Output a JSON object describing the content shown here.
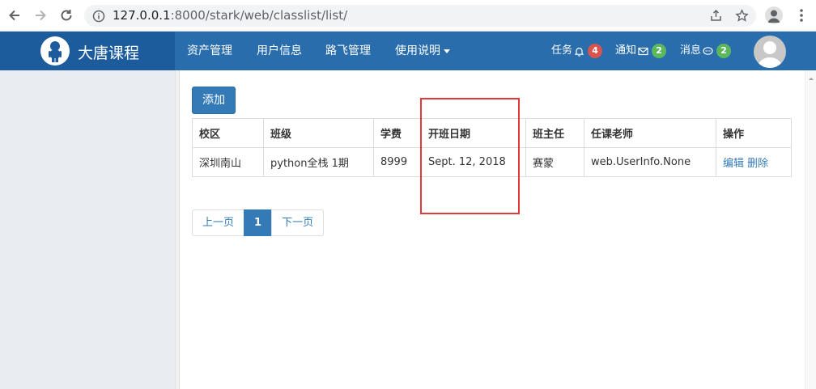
{
  "browser": {
    "url_host": "127.0.0.1",
    "url_rest": ":8000/stark/web/classlist/list/"
  },
  "navbar": {
    "brand": "大唐课程",
    "menus": [
      "资产管理",
      "用户信息",
      "路飞管理",
      "使用说明"
    ],
    "tasks": {
      "label": "任务",
      "count": "4",
      "color": "#d9534f"
    },
    "notices": {
      "label": "通知",
      "count": "2",
      "color": "#5cb85c"
    },
    "messages": {
      "label": "消息",
      "count": "2",
      "color": "#5cb85c"
    }
  },
  "content": {
    "add_label": "添加",
    "table": {
      "headers": [
        "校区",
        "班级",
        "学费",
        "开班日期",
        "班主任",
        "任课老师",
        "操作"
      ],
      "rows": [
        {
          "campus": "深圳南山",
          "class": "python全栈 1期",
          "fee": "8999",
          "start_date": "Sept. 12, 2018",
          "head_teacher": "赛蒙",
          "teachers": "web.UserInfo.None",
          "edit": "编辑",
          "delete": "删除"
        }
      ]
    },
    "pager": {
      "prev": "上一页",
      "current": "1",
      "next": "下一页"
    }
  },
  "colors": {
    "navbar": "#2a6dad",
    "brand_bg": "#1d5c9c",
    "primary": "#337ab7",
    "highlight": "#e3393b"
  }
}
